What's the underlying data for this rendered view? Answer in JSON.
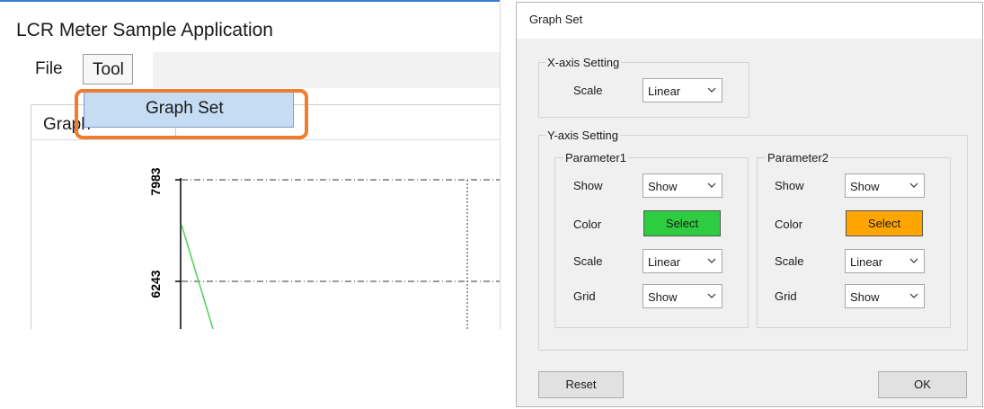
{
  "app": {
    "title": "LCR Meter Sample Application",
    "menu": {
      "file": "File",
      "tool": "Tool"
    },
    "dropdown_item": "Graph Set",
    "tab_label": "Graph",
    "highlight_color": "#ee7d30"
  },
  "chart_data": {
    "type": "line",
    "yticks": [
      "7983",
      "6243"
    ],
    "series": [
      {
        "values": [
          7500,
          5700
        ]
      }
    ],
    "series_color": "#5ad35a",
    "grid": true
  },
  "dialog": {
    "title": "Graph Set",
    "x_axis": {
      "group_label": "X-axis Setting",
      "scale_label": "Scale",
      "scale_value": "Linear"
    },
    "y_axis": {
      "group_label": "Y-axis Setting",
      "param1": {
        "label": "Parameter1",
        "show_label": "Show",
        "show_value": "Show",
        "color_label": "Color",
        "color_button": "Select",
        "color": "#2ecc40",
        "scale_label": "Scale",
        "scale_value": "Linear",
        "grid_label": "Grid",
        "grid_value": "Show"
      },
      "param2": {
        "label": "Parameter2",
        "show_label": "Show",
        "show_value": "Show",
        "color_label": "Color",
        "color_button": "Select",
        "color": "#ffa500",
        "scale_label": "Scale",
        "scale_value": "Linear",
        "grid_label": "Grid",
        "grid_value": "Show"
      }
    },
    "reset_label": "Reset",
    "ok_label": "OK"
  }
}
